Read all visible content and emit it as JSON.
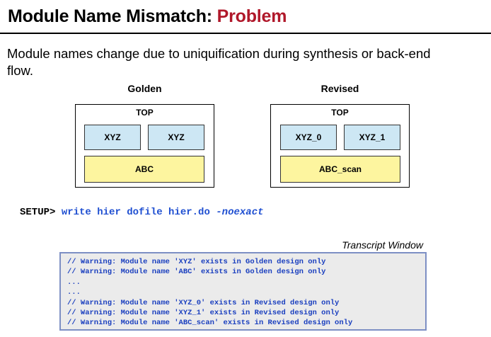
{
  "title": {
    "main": "Module Name Mismatch: ",
    "accent": "Problem",
    "accent_color": "#b0182a"
  },
  "intro_text": "Module names change due to uniquification during synthesis or back-end flow.",
  "golden": {
    "label": "Golden",
    "top_label": "TOP",
    "sub_modules": [
      "XYZ",
      "XYZ"
    ],
    "bottom_module": "ABC"
  },
  "revised": {
    "label": "Revised",
    "top_label": "TOP",
    "sub_modules": [
      "XYZ_0",
      "XYZ_1"
    ],
    "bottom_module": "ABC_scan"
  },
  "setup": {
    "prompt": "SETUP>",
    "command": "write hier dofile hier.do",
    "option": "-noexact"
  },
  "transcript": {
    "label": "Transcript Window",
    "lines": [
      "// Warning: Module name 'XYZ' exists in Golden design only",
      "// Warning: Module name 'ABC' exists in Golden design only",
      "...",
      "...",
      "// Warning: Module name 'XYZ_0' exists in Revised design only",
      "// Warning: Module name 'XYZ_1' exists in Revised design only",
      "// Warning: Module name 'ABC_scan' exists in Revised design only"
    ]
  },
  "colors": {
    "module_blue": "#cde7f4",
    "module_yellow": "#fdf59f",
    "command_blue": "#1f4fd1",
    "transcript_text": "#1a3fbf",
    "transcript_bg": "#ebebeb"
  }
}
